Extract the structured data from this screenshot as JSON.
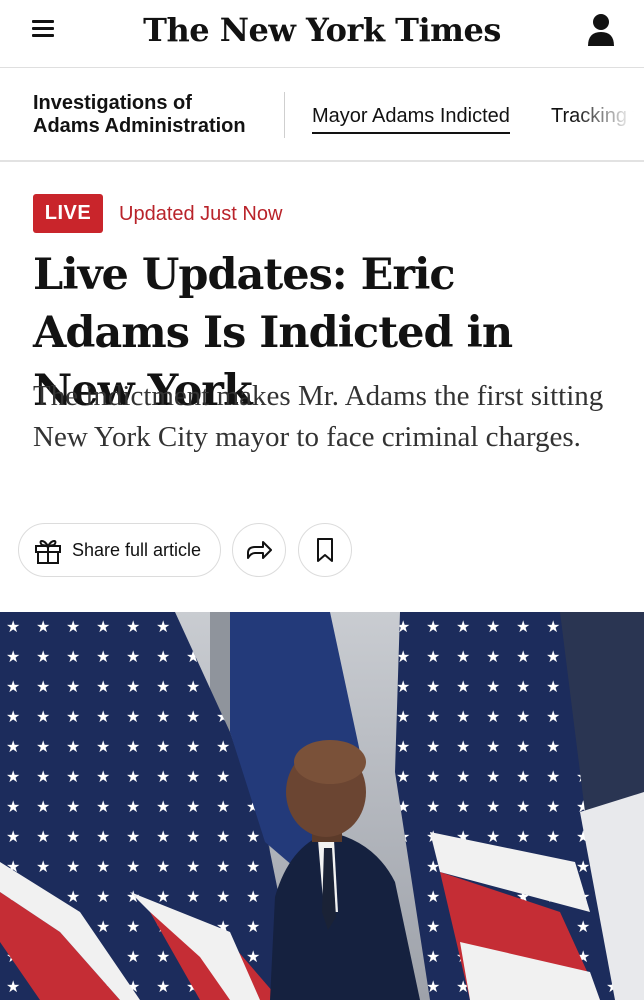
{
  "masthead": {
    "logo_text": "The New York Times",
    "menu_icon": "hamburger-menu-icon",
    "account_icon": "account-icon"
  },
  "nav": {
    "section_title_line1": "Investigations of",
    "section_title_line2": "Adams Administration",
    "tabs": [
      {
        "label": "Mayor Adams Indicted",
        "active": true
      },
      {
        "label": "Tracking t",
        "active": false
      }
    ]
  },
  "article": {
    "live_badge": "LIVE",
    "updated_text": "Updated Just Now",
    "headline": "Live Updates: Eric Adams Is Indicted in New York",
    "summary": "The indictment makes Mr. Adams the first sitting New York City mayor to face criminal charges.",
    "share_label": "Share full article",
    "share_icon": "gift-icon",
    "forward_icon": "share-arrow-icon",
    "bookmark_icon": "bookmark-icon"
  },
  "colors": {
    "live_red": "#c9252b",
    "updated_red": "#b9232a",
    "text": "#121212",
    "flag_blue": "#1b2a58",
    "flag_red": "#c52d35",
    "suit_navy": "#15213f"
  }
}
